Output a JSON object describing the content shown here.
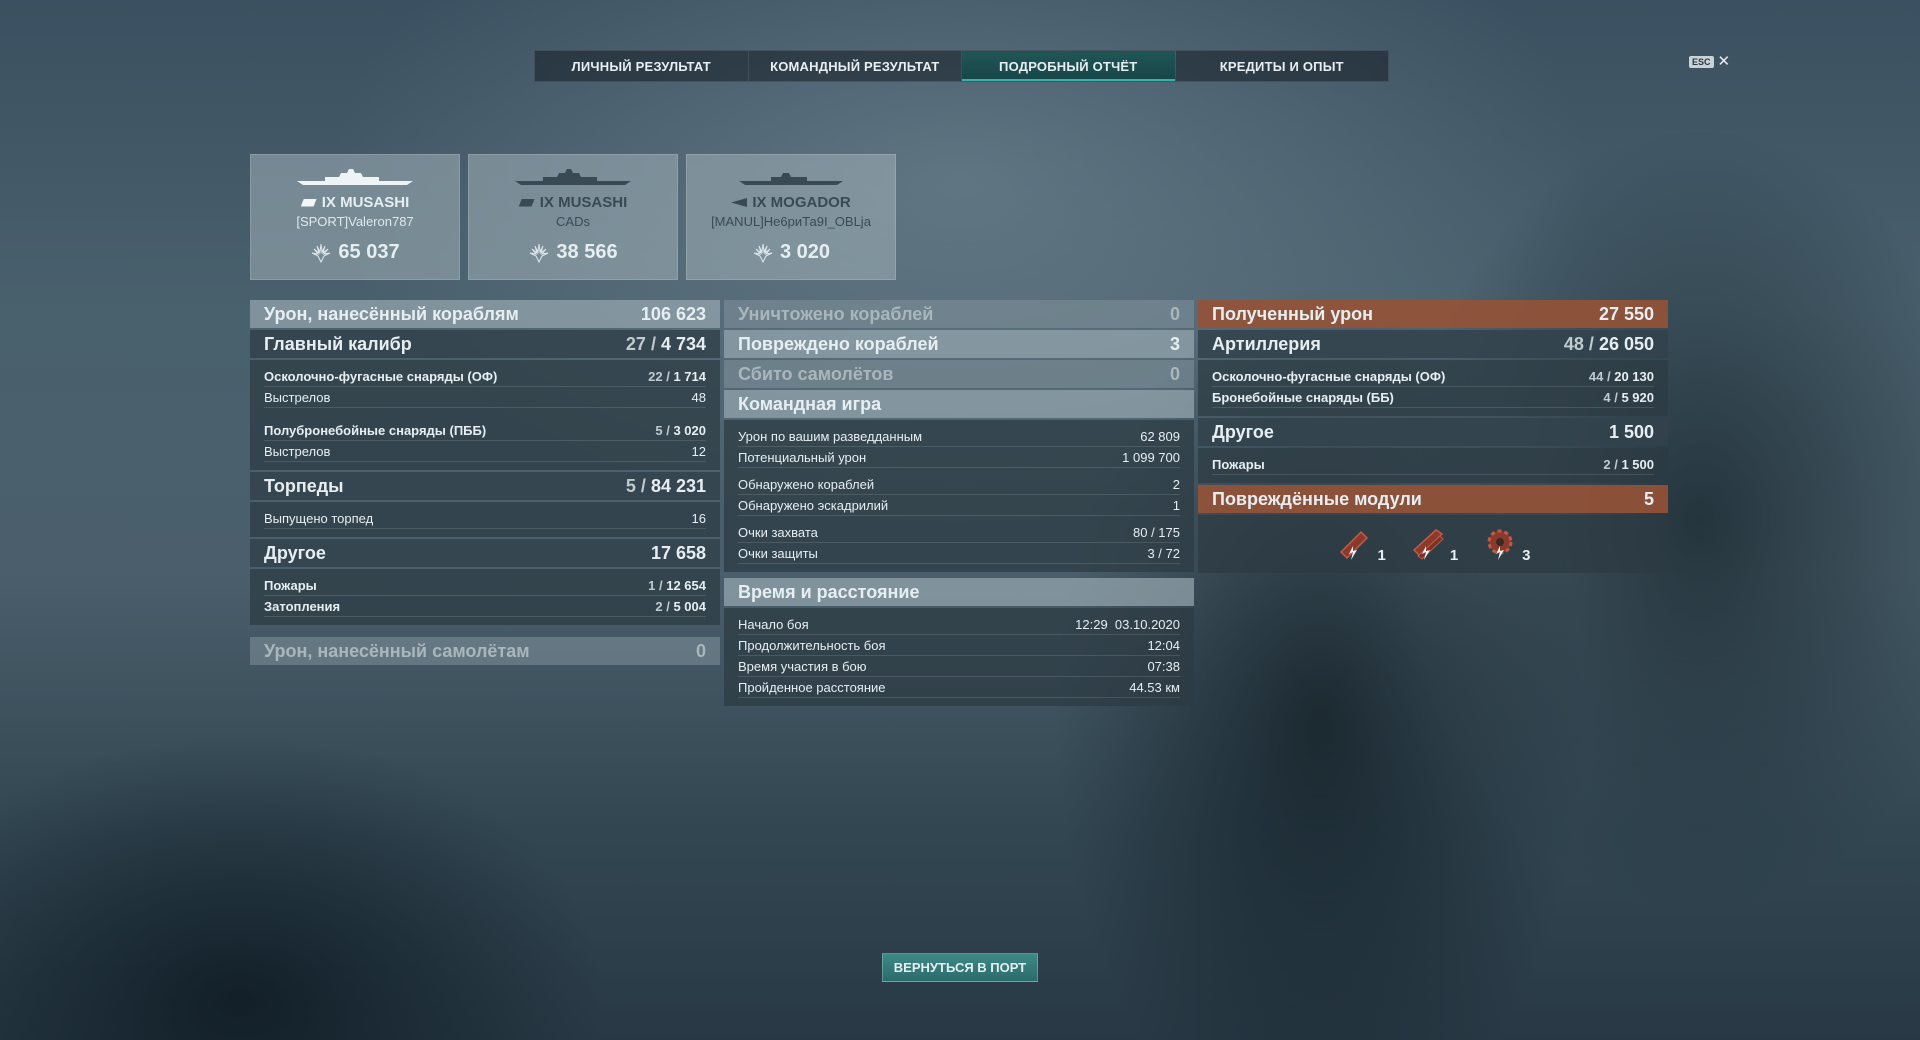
{
  "tabs": [
    "ЛИЧНЫЙ РЕЗУЛЬТАТ",
    "КОМАНДНЫЙ РЕЗУЛЬТАТ",
    "ПОДРОБНЫЙ ОТЧЁТ",
    "КРЕДИТЫ И ОПЫТ"
  ],
  "active_tab": "ПОДРОБНЫЙ ОТЧЁТ",
  "esc": {
    "key": "ESC",
    "close": "✕"
  },
  "cards": [
    {
      "ship": "IX MUSASHI",
      "player": "[SPORT]Valeron787",
      "score": "65 037"
    },
    {
      "ship": "IX MUSASHI",
      "player": "CADs",
      "score": "38 566"
    },
    {
      "ship": "IX MOGADOR",
      "player": "[MANUL]Не6риТа9I_OBLja",
      "score": "3 020"
    }
  ],
  "left": {
    "ship_damage": {
      "label": "Урон, нанесённый кораблям",
      "value": "106 623"
    },
    "main_battery": {
      "label": "Главный калибр",
      "hits": "27",
      "value": "4 734"
    },
    "he": {
      "label": "Осколочно-фугасные снаряды (ОФ)",
      "hits": "22",
      "value": "1 714"
    },
    "he_shots": {
      "label": "Выстрелов",
      "value": "48"
    },
    "sap": {
      "label": "Полубронебойные снаряды (ПББ)",
      "hits": "5",
      "value": "3 020"
    },
    "sap_shots": {
      "label": "Выстрелов",
      "value": "12"
    },
    "torpedoes": {
      "label": "Торпеды",
      "hits": "5",
      "value": "84 231"
    },
    "torp_launched": {
      "label": "Выпущено торпед",
      "value": "16"
    },
    "other": {
      "label": "Другое",
      "value": "17 658"
    },
    "fires": {
      "label": "Пожары",
      "hits": "1",
      "value": "12 654"
    },
    "floods": {
      "label": "Затопления",
      "hits": "2",
      "value": "5 004"
    },
    "plane_damage": {
      "label": "Урон, нанесённый самолётам",
      "value": "0"
    }
  },
  "middle": {
    "destroyed": {
      "label": "Уничтожено кораблей",
      "value": "0"
    },
    "damaged": {
      "label": "Повреждено кораблей",
      "value": "3"
    },
    "planes": {
      "label": "Сбито самолётов",
      "value": "0"
    },
    "teamplay": {
      "label": "Командная игра"
    },
    "spot_dmg": {
      "label": "Урон по вашим разведданным",
      "value": "62 809"
    },
    "potential": {
      "label": "Потенциальный урон",
      "value": "1 099 700"
    },
    "spot_ships": {
      "label": "Обнаружено кораблей",
      "value": "2"
    },
    "spot_squad": {
      "label": "Обнаружено эскадрилий",
      "value": "1"
    },
    "capture": {
      "label": "Очки захвата",
      "value": "80 / 175"
    },
    "defense": {
      "label": "Очки защиты",
      "value": "3 / 72"
    },
    "timing": {
      "label": "Время и расстояние"
    },
    "start": {
      "label": "Начало боя",
      "value": "12:29  03.10.2020"
    },
    "duration": {
      "label": "Продолжительность боя",
      "value": "12:04"
    },
    "time_in": {
      "label": "Время участия в бою",
      "value": "07:38"
    },
    "distance": {
      "label": "Пройденное расстояние",
      "value": "44.53 км"
    }
  },
  "right": {
    "received": {
      "label": "Полученный урон",
      "value": "27 550"
    },
    "artillery": {
      "label": "Артиллерия",
      "hits": "48",
      "value": "26 050"
    },
    "he": {
      "label": "Осколочно-фугасные снаряды (ОФ)",
      "hits": "44",
      "value": "20 130"
    },
    "ap": {
      "label": "Бронебойные снаряды (ББ)",
      "hits": "4",
      "value": "5 920"
    },
    "other": {
      "label": "Другое",
      "value": "1 500"
    },
    "fires": {
      "label": "Пожары",
      "hits": "2",
      "value": "1 500"
    },
    "modules": {
      "label": "Повреждённые модули",
      "value": "5"
    },
    "module_counts": [
      "1",
      "1",
      "3"
    ]
  },
  "return_button": "ВЕРНУТЬСЯ В ПОРТ",
  "colors": {
    "accent_teal": "#2a6b6a",
    "received_brown": "#965236"
  }
}
